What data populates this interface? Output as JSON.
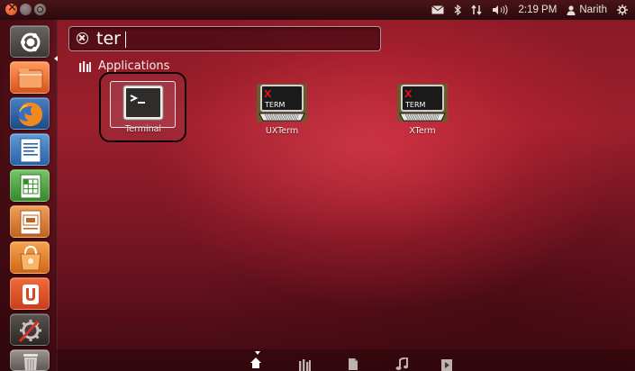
{
  "panel": {
    "clock": "2:19 PM",
    "user": "Narith"
  },
  "search": {
    "query": "ter"
  },
  "category": {
    "label": "Applications"
  },
  "results": [
    {
      "label": "Terminal",
      "icon": "terminal-icon",
      "selected": true
    },
    {
      "label": "UXTerm",
      "icon": "xterm-icon",
      "selected": false
    },
    {
      "label": "XTerm",
      "icon": "xterm-icon",
      "selected": false
    }
  ],
  "xterm_icon_text": {
    "x": "X",
    "term": "TERM"
  },
  "launcher": [
    "ubuntu-dash-icon",
    "home-folder-icon",
    "firefox-icon",
    "writer-icon",
    "calc-icon",
    "impress-icon",
    "software-center-icon",
    "ubuntu-one-icon",
    "system-settings-icon",
    "trash-icon"
  ],
  "lenses": [
    "home-lens-icon",
    "applications-lens-icon",
    "files-lens-icon",
    "music-lens-icon",
    "video-lens-icon"
  ],
  "colors": {
    "accent": "#c62436",
    "panel": "#2a0a0d",
    "text": "#ffffff"
  }
}
